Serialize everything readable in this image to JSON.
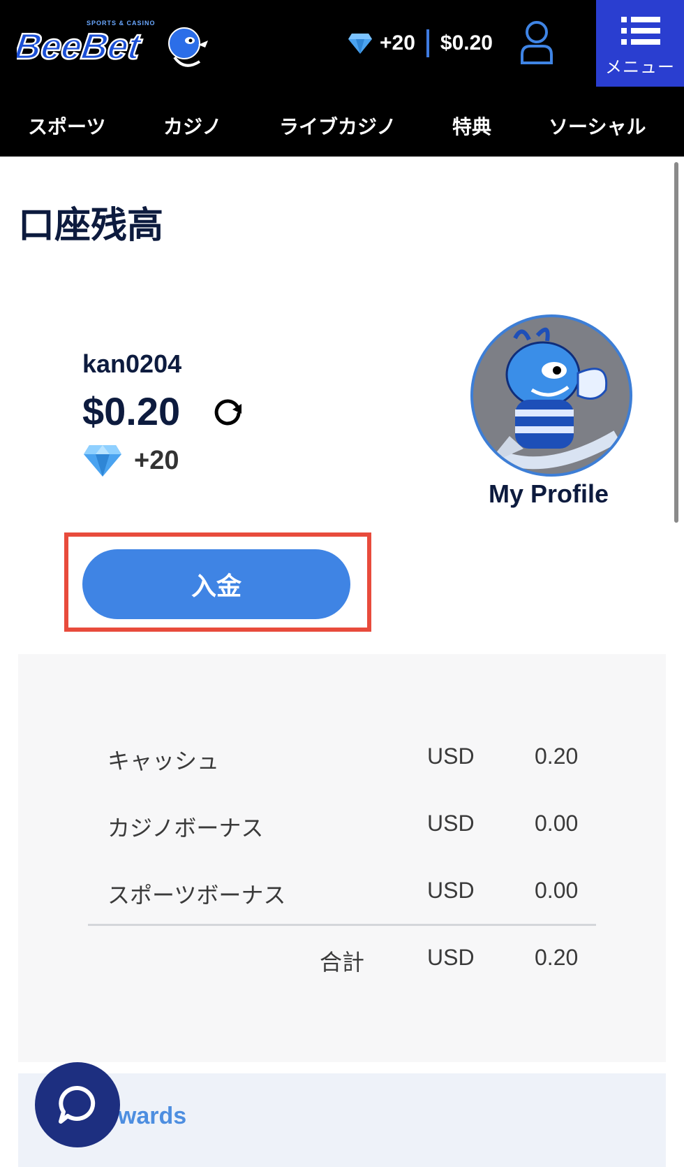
{
  "header": {
    "logo_text": "BeeBet",
    "logo_subtext": "SPORTS & CASINO",
    "points": "+20",
    "balance": "$0.20",
    "menu_label": "メニュー"
  },
  "nav": {
    "items": [
      {
        "label": "スポーツ"
      },
      {
        "label": "カジノ"
      },
      {
        "label": "ライブカジノ"
      },
      {
        "label": "特典"
      },
      {
        "label": "ソーシャル"
      }
    ]
  },
  "page": {
    "title": "口座残高"
  },
  "account": {
    "username": "kan0204",
    "amount": "$0.20",
    "points": "+20",
    "profile_label": "My Profile",
    "deposit_label": "入金"
  },
  "balances": {
    "rows": [
      {
        "label": "キャッシュ",
        "currency": "USD",
        "value": "0.20"
      },
      {
        "label": "カジノボーナス",
        "currency": "USD",
        "value": "0.00"
      },
      {
        "label": "スポーツボーナス",
        "currency": "USD",
        "value": "0.00"
      }
    ],
    "total": {
      "label": "合計",
      "currency": "USD",
      "value": "0.20"
    }
  },
  "rewards": {
    "label": "ewards"
  },
  "colors": {
    "header_bg": "#000000",
    "menu_bg": "#2a3ed0",
    "accent": "#3f84e4",
    "highlight": "#e84b3c",
    "text_dark": "#0d1b3e",
    "chat_bg": "#1d2f80"
  }
}
